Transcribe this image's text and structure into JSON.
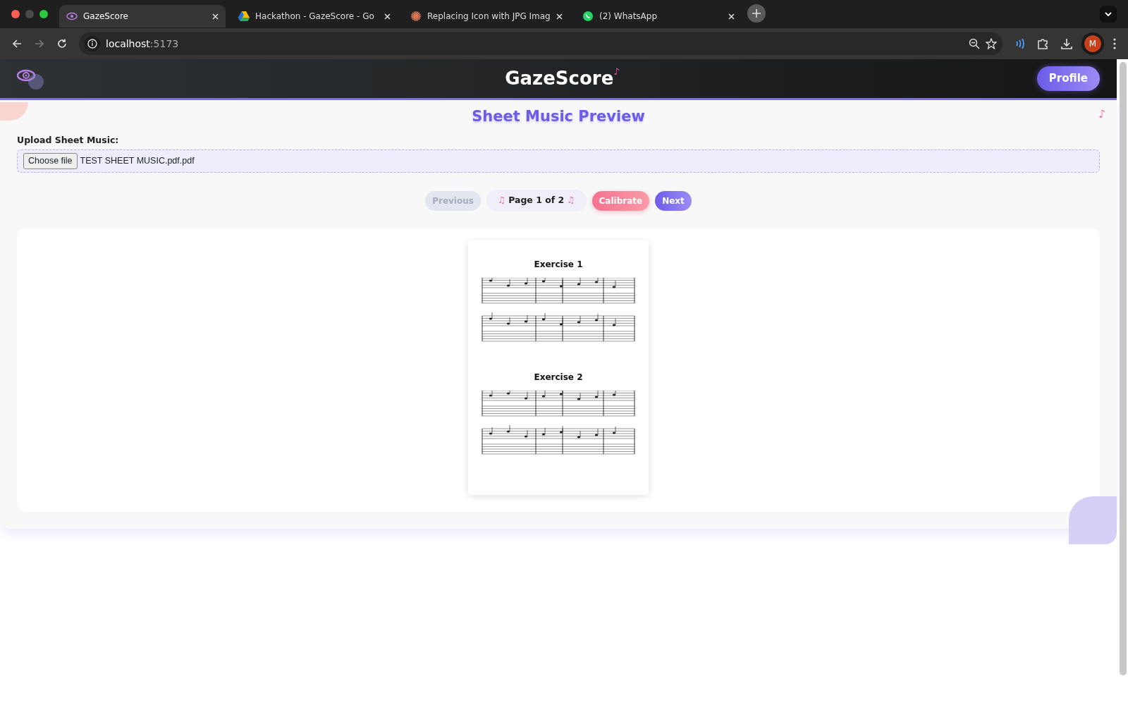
{
  "browser": {
    "tabs": [
      {
        "title": "GazeScore",
        "selected": true
      },
      {
        "title": "Hackathon - GazeScore - Go",
        "selected": false
      },
      {
        "title": "Replacing Icon with JPG Imag",
        "selected": false
      },
      {
        "title": "(2) WhatsApp",
        "selected": false
      }
    ],
    "address": {
      "host": "localhost",
      "port": ":5173"
    },
    "profile_initial": "M"
  },
  "app": {
    "brand": "GazeScore",
    "brand_note": "♪",
    "profile_button": "Profile",
    "title": "Sheet Music Preview",
    "corner_note": "♪",
    "upload": {
      "label": "Upload Sheet Music:",
      "button": "Choose file",
      "file_name": "TEST SHEET MUSIC.pdf.pdf"
    },
    "pager": [
      {
        "kind": "previous",
        "label": "Previous",
        "disabled": true
      },
      {
        "kind": "indicator",
        "label": "Page 1 of 2",
        "note": "♫"
      },
      {
        "kind": "calibrate",
        "label": "Calibrate",
        "disabled": false
      },
      {
        "kind": "next",
        "label": "Next",
        "disabled": false
      }
    ],
    "document": {
      "exercises": [
        {
          "title": "Exercise 1"
        },
        {
          "title": "Exercise 2"
        }
      ]
    }
  }
}
